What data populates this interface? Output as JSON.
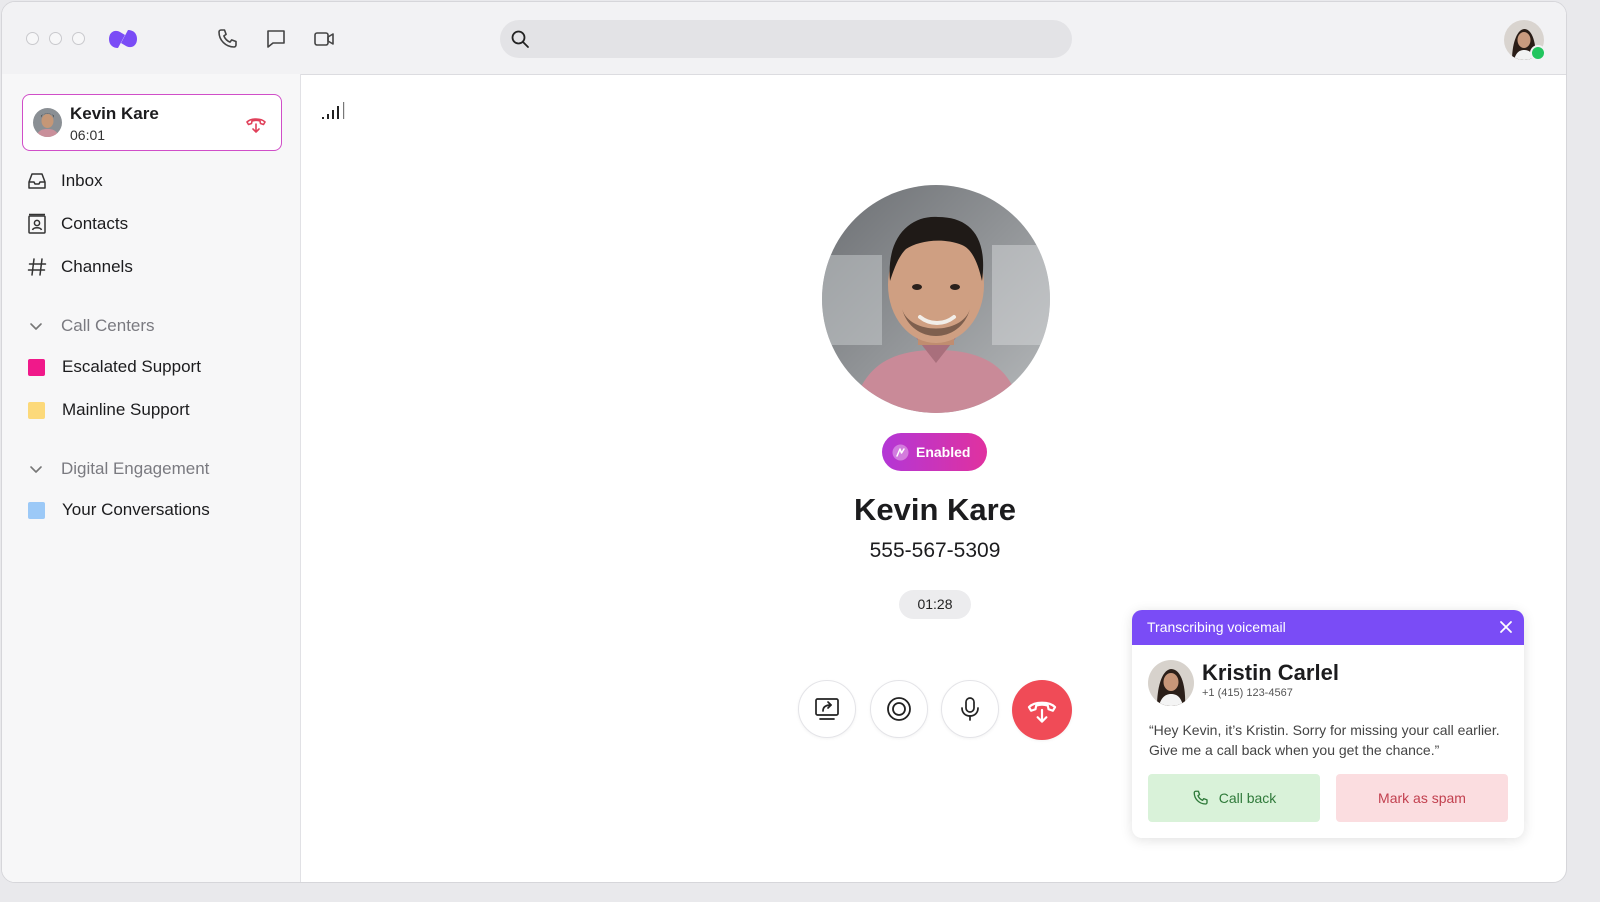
{
  "app": {
    "window_buttons": [
      "close",
      "minimize",
      "maximize"
    ],
    "logo_icon": "app-logo-icon",
    "brand_color": "#7a4cf6",
    "top_icons": [
      "phone-icon",
      "message-icon",
      "video-icon"
    ]
  },
  "search": {
    "placeholder": "",
    "value": ""
  },
  "active_call": {
    "name": "Kevin Kare",
    "time": "06:01"
  },
  "sidebar": {
    "items": [
      {
        "label": "Inbox",
        "icon": "inbox-icon"
      },
      {
        "label": "Contacts",
        "icon": "contacts-icon"
      },
      {
        "label": "Channels",
        "icon": "hash-icon"
      }
    ],
    "sections": [
      {
        "label": "Call Centers",
        "items": [
          {
            "label": "Escalated Support",
            "color": "#f0198a"
          },
          {
            "label": "Mainline Support",
            "color": "#fcd97a"
          }
        ]
      },
      {
        "label": "Digital Engagement",
        "items": [
          {
            "label": "Your Conversations",
            "color": "#9cc9f7"
          }
        ]
      }
    ]
  },
  "call": {
    "badge": "Enabled",
    "name": "Kevin Kare",
    "number": "555-567-5309",
    "duration": "01:28",
    "controls": [
      "screen-share-icon",
      "record-icon",
      "microphone-icon",
      "end-call-icon"
    ],
    "end_color": "#f04b57"
  },
  "voicemail": {
    "header": "Transcribing voicemail",
    "name": "Kristin Carlel",
    "phone": "+1 (415) 123-4567",
    "transcript": "“Hey Kevin, it’s Kristin. Sorry for missing your call earlier. Give me a call back when you get the chance.”",
    "call_back_label": "Call back",
    "spam_label": "Mark as spam"
  }
}
